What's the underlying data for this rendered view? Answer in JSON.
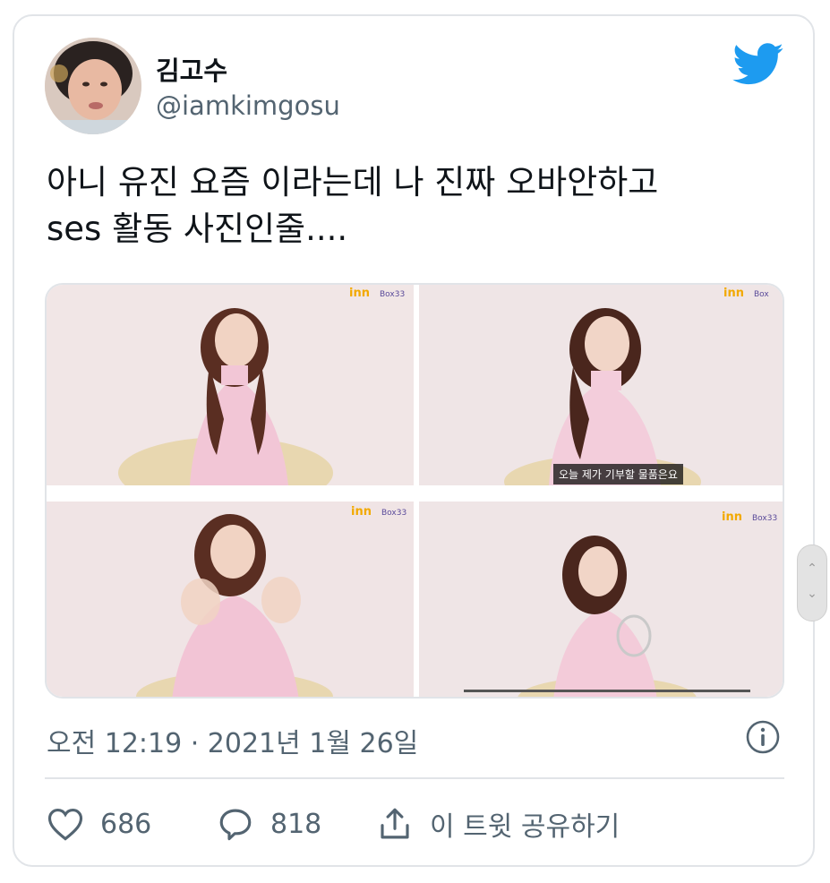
{
  "tweet": {
    "author_name": "김고수",
    "author_handle": "@iamkimgosu",
    "text_line1": "아니 유진 요즘 이라는데 나 진짜 오바안하고",
    "text_line2": "ses 활동 사진인줄....",
    "timestamp": "오전 12:19 · 2021년 1월 26일",
    "likes": "686",
    "replies": "818",
    "share_label": "이 트윗 공유하기"
  },
  "photos": [
    {
      "logo": "inn",
      "box_text": "Box33",
      "subtitle": ""
    },
    {
      "logo": "inn",
      "box_text": "Box",
      "subtitle": "오늘 제가 기부할 물품은요"
    },
    {
      "logo": "inn",
      "box_text": "Box33",
      "subtitle": ""
    },
    {
      "logo": "inn",
      "box_text": "Box33",
      "subtitle": ""
    }
  ],
  "icons": {
    "brand": "twitter-bird-icon",
    "info": "info-icon",
    "like": "heart-icon",
    "reply": "speech-bubble-icon",
    "share": "share-icon"
  },
  "colors": {
    "twitter_blue": "#1d9bf0",
    "secondary_text": "#536471",
    "border": "#e1e4e8"
  }
}
